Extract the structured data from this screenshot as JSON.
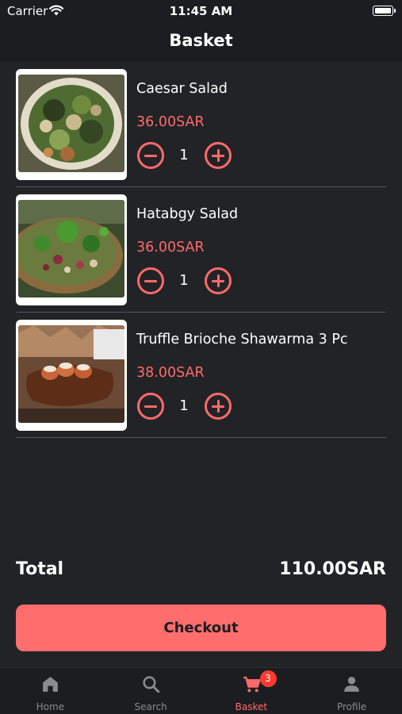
{
  "status_bar": {
    "carrier": "Carrier",
    "time": "11:45 AM"
  },
  "nav": {
    "title": "Basket"
  },
  "basket": {
    "items": [
      {
        "name": "Caesar Salad",
        "price": "36.00SAR",
        "quantity": "1"
      },
      {
        "name": "Hatabgy Salad",
        "price": "36.00SAR",
        "quantity": "1"
      },
      {
        "name": "Truffle Brioche Shawarma 3 Pc",
        "price": "38.00SAR",
        "quantity": "1"
      }
    ]
  },
  "summary": {
    "total_label": "Total",
    "total_value": "110.00SAR"
  },
  "checkout": {
    "label": "Checkout"
  },
  "tab_bar": {
    "tabs": [
      {
        "label": "Home",
        "icon": "home-icon"
      },
      {
        "label": "Search",
        "icon": "search-icon"
      },
      {
        "label": "Basket",
        "icon": "cart-icon",
        "badge": "3",
        "active": true
      },
      {
        "label": "Profile",
        "icon": "person-icon"
      }
    ]
  },
  "colors": {
    "accent": "#ff6a6a",
    "background": "#222326",
    "bar_background": "#1c1d20",
    "badge": "#ff3b30"
  }
}
